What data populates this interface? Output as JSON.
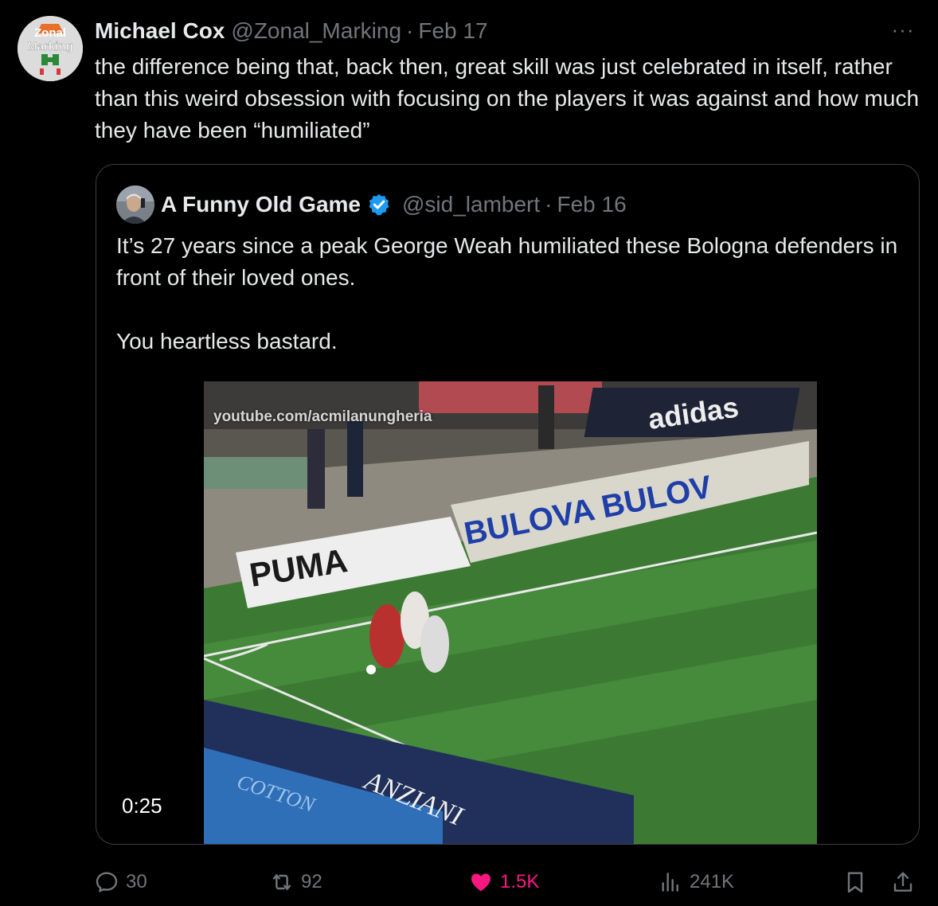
{
  "tweet": {
    "author_name": "Michael Cox",
    "author_handle": "@Zonal_Marking",
    "separator": "·",
    "date": "Feb 17",
    "avatar_text_top": "Zonal",
    "avatar_text_bottom": "Marking",
    "more_label": "···",
    "text": "the difference being that, back then, great skill was just celebrated in itself, rather than this weird obsession with focusing on the players it was against and how much they have been “humiliated”"
  },
  "quoted_tweet": {
    "author_name": "A Funny Old Game",
    "author_handle": "@sid_lambert",
    "separator": "·",
    "date": "Feb 16",
    "verified": true,
    "text": "It’s 27 years since a peak George Weah humiliated these Bologna defenders in front of their loved ones.\n\nYou heartless bastard.",
    "video": {
      "watermark": "youtube.com/acmilanungheria",
      "duration": "0:25",
      "board_puma": "PUMA",
      "board_bulova": "BULOVA BULOV",
      "board_adidas": "adidas",
      "board_anziani": "ANZIANI",
      "board_cotton": "COTTON"
    }
  },
  "actions": {
    "replies": "30",
    "retweets": "92",
    "likes": "1.5K",
    "views": "241K"
  },
  "colors": {
    "background": "#000000",
    "text_primary": "#e7e9ea",
    "text_secondary": "#71767b",
    "like_active": "#f91880",
    "verified": "#1d9bf0",
    "quote_border": "#3c3f44"
  }
}
